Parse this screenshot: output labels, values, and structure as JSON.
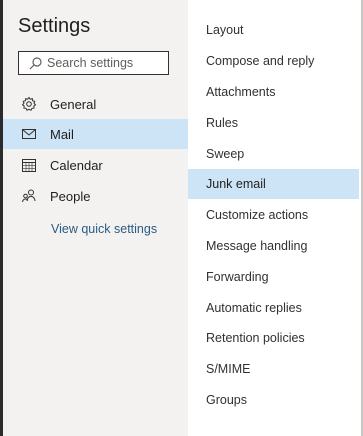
{
  "settings": {
    "title": "Settings",
    "search_placeholder": "Search settings",
    "nav": [
      {
        "label": "General",
        "icon": "gear-icon"
      },
      {
        "label": "Mail",
        "icon": "mail-icon",
        "selected": true
      },
      {
        "label": "Calendar",
        "icon": "calendar-icon"
      },
      {
        "label": "People",
        "icon": "people-icon"
      }
    ],
    "quick_settings_link": "View quick settings"
  },
  "mail_settings": {
    "items": [
      "Layout",
      "Compose and reply",
      "Attachments",
      "Rules",
      "Sweep",
      "Junk email",
      "Customize actions",
      "Message handling",
      "Forwarding",
      "Automatic replies",
      "Retention policies",
      "S/MIME",
      "Groups"
    ],
    "selected": "Junk email"
  },
  "colors": {
    "selected_bg": "#cce4f6",
    "nav_bg": "#f3f2f1",
    "link": "#2b5b83"
  }
}
